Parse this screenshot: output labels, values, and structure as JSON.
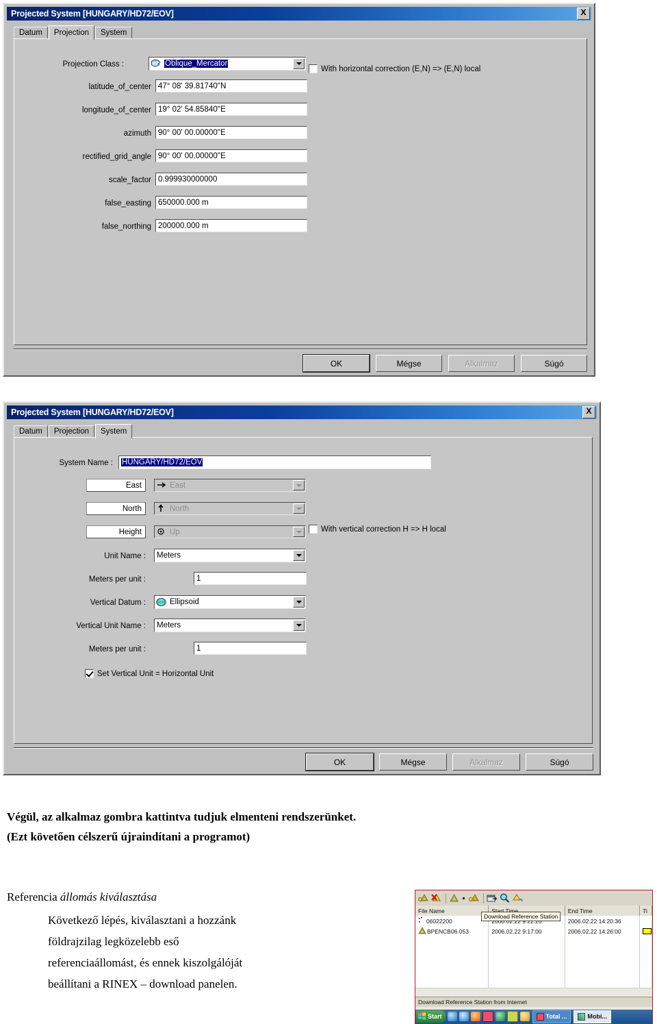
{
  "dialog1": {
    "title": "Projected System [HUNGARY/HD72/EOV]",
    "close_label": "X",
    "tabs": [
      {
        "label": "Datum",
        "active": false
      },
      {
        "label": "Projection",
        "active": true
      },
      {
        "label": "System",
        "active": false
      }
    ],
    "projection_class": {
      "label": "Projection Class :",
      "value": "Oblique_Mercator",
      "icon": "projection-class-icon"
    },
    "fields": [
      {
        "label": "latitude_of_center",
        "value": "47° 08' 39.81740''N"
      },
      {
        "label": "longitude_of_center",
        "value": "19° 02' 54.85840''E"
      },
      {
        "label": "azimuth",
        "value": "90° 00' 00.00000''E"
      },
      {
        "label": "rectified_grid_angle",
        "value": "90° 00' 00.00000''E"
      },
      {
        "label": "scale_factor",
        "value": "0.999930000000"
      },
      {
        "label": "false_easting",
        "value": "650000.000 m"
      },
      {
        "label": "false_northing",
        "value": "200000.000 m"
      }
    ],
    "horizontal_correction": {
      "label": "With horizontal correction (E,N) => (E,N) local",
      "checked": false
    },
    "buttons": [
      {
        "label": "OK",
        "default": true,
        "disabled": false
      },
      {
        "label": "Mégse",
        "default": false,
        "disabled": false
      },
      {
        "label": "Alkalmaz",
        "default": false,
        "disabled": true
      },
      {
        "label": "Súgó",
        "default": false,
        "disabled": false
      }
    ]
  },
  "dialog2": {
    "title": "Projected System [HUNGARY/HD72/EOV]",
    "close_label": "X",
    "tabs": [
      {
        "label": "Datum",
        "active": false
      },
      {
        "label": "Projection",
        "active": false
      },
      {
        "label": "System",
        "active": true
      }
    ],
    "system_name": {
      "label": "System Name :",
      "value": "HUNGARY/HD72/EOV"
    },
    "axes": [
      {
        "button": "East",
        "combo": "East",
        "icon": "arrow-right-icon",
        "disabled": true
      },
      {
        "button": "North",
        "combo": "North",
        "icon": "arrow-up-icon",
        "disabled": true
      },
      {
        "button": "Height",
        "combo": "Up",
        "icon": "dot-target-icon",
        "disabled": true
      }
    ],
    "unit_name": {
      "label": "Unit Name :",
      "value": "Meters"
    },
    "meters_per_unit_1": {
      "label": "Meters per unit :",
      "value": "1"
    },
    "vertical_datum": {
      "label": "Vertical Datum :",
      "value": "Ellipsoid",
      "icon": "ellipsoid-globe-icon"
    },
    "vertical_unit_name": {
      "label": "Vertical Unit Name :",
      "value": "Meters"
    },
    "meters_per_unit_2": {
      "label": "Meters per unit :",
      "value": "1"
    },
    "set_vertical_unit": {
      "label": "Set Vertical Unit = Horizontal Unit",
      "checked": true
    },
    "vertical_correction": {
      "label": "With vertical correction H => H local",
      "checked": false
    },
    "buttons": [
      {
        "label": "OK",
        "default": true,
        "disabled": false
      },
      {
        "label": "Mégse",
        "default": false,
        "disabled": false
      },
      {
        "label": "Alkalmaz",
        "default": false,
        "disabled": true
      },
      {
        "label": "Súgó",
        "default": false,
        "disabled": false
      }
    ]
  },
  "document": {
    "line1": "Végül, az alkalmaz gombra kattintva tudjuk elmenteni rendszerünket.",
    "line2": "(Ezt követően célszerű újraindítani a programot)",
    "heading_plain": "Referencia ",
    "heading_italic": "állomás kiválasztása",
    "body": [
      "Következő lépés, kiválasztani a hozzánk",
      "földrajzilag legközelebb eső",
      "referenciaállomást, és ennek kiszolgálóját",
      "beállítani a RINEX – download panelen."
    ]
  },
  "rinex": {
    "toolbar_icons": [
      "add-reference-station-icon",
      "delete-reference-station-icon",
      "reference-station-icon",
      "dropdown-dot-icon",
      "download-reference-station-icon",
      "properties-icon",
      "search-icon",
      "convert-icon"
    ],
    "columns": [
      "File Name",
      "Start Time",
      "End Time",
      "Ti"
    ],
    "rows": [
      {
        "icon": "dots-icon",
        "file": "06022200",
        "start": "2006.02.22   9:22:26",
        "end": "2006.02.22   14:20:36",
        "bar": false
      },
      {
        "icon": "triangle-icon",
        "file": "BPENCB06.053",
        "start": "2006.02.22   9:17:00",
        "end": "2006.02.22   14:26:00",
        "bar": true
      }
    ],
    "tooltip": "Download Reference Station",
    "status": "Download Reference Station from Internet",
    "taskbar": {
      "start": "Start",
      "buttons": [
        "Total ...",
        "Mobi..."
      ]
    }
  },
  "colors": {
    "titlebar_start": "#0a246a",
    "titlebar_end": "#5aa4e4",
    "dialog_face": "#c0c0c0",
    "selection": "#000080",
    "rinex_border": "#b02020",
    "highlight_yellow": "#ffff00"
  }
}
